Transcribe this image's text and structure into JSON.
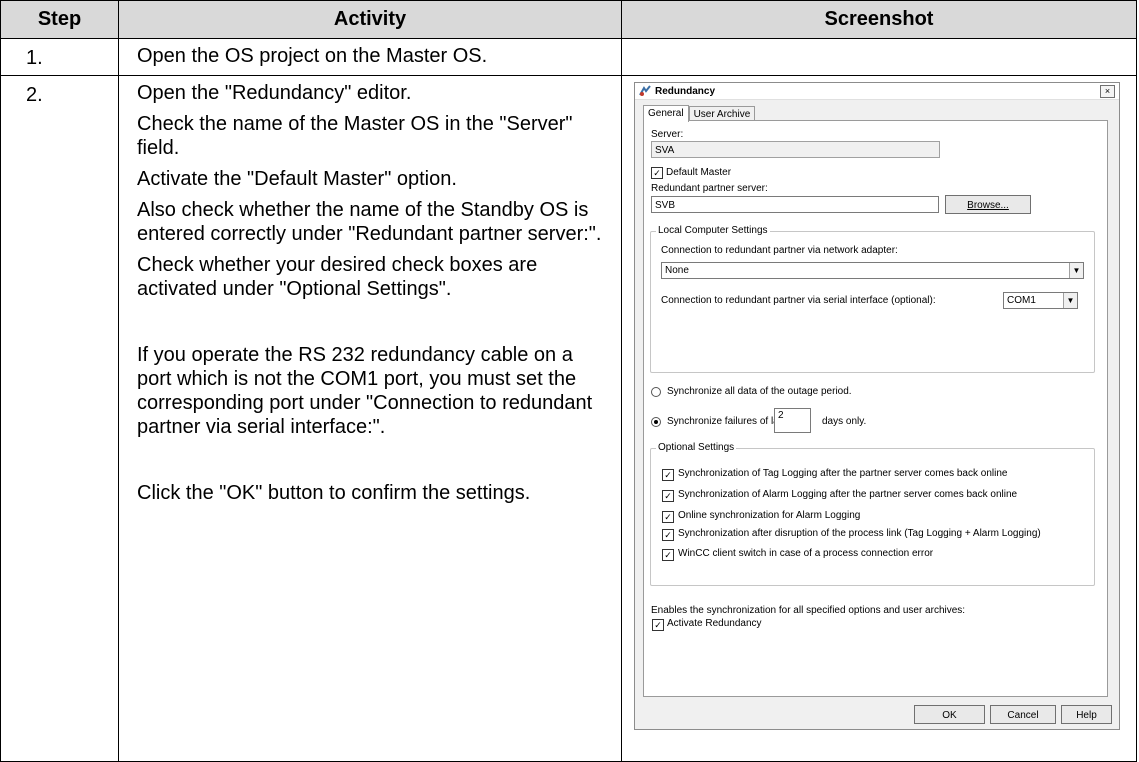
{
  "table": {
    "headers": [
      "Step",
      "Activity",
      "Screenshot"
    ],
    "rows": [
      {
        "step": "1.",
        "activity": [
          "Open the OS project on the Master OS."
        ]
      },
      {
        "step": "2.",
        "activity": [
          "Open the \"Redundancy\" editor.",
          "Check the name of the Master OS in the \"Server\" field.",
          "Activate the \"Default Master\" option.",
          "Also check whether the name of the Standby OS is entered correctly under \"Redundant partner server:\".",
          "Check whether your desired check boxes are activated under \"Optional Settings\".",
          "If you operate the RS 232 redundancy cable on a port which is not the COM1 port, you must set the corresponding port under \"Connection to redundant partner via serial interface:\".",
          "Click the \"OK\" button to confirm the settings."
        ]
      }
    ]
  },
  "dialog": {
    "title": "Redundancy",
    "close_glyph": "×",
    "tabs": [
      "General",
      "User Archive"
    ],
    "server_label": "Server:",
    "server_value": "SVA",
    "default_master_label": "Default Master",
    "default_master_checked": true,
    "partner_label": "Redundant partner server:",
    "partner_value": "SVB",
    "browse_label": "Browse...",
    "local_group": {
      "legend": "Local Computer Settings",
      "network_label": "Connection to redundant partner via network adapter:",
      "network_value": "None",
      "serial_label": "Connection to redundant partner via serial interface (optional):",
      "serial_value": "COM1"
    },
    "sync_all_label": "Synchronize all data of the outage period.",
    "sync_last_label": "Synchronize failures of last",
    "sync_days_value": "2",
    "sync_days_suffix": "days only.",
    "sync_selected": "last",
    "optional_group": {
      "legend": "Optional Settings",
      "options": [
        "Synchronization of Tag Logging after the partner server comes back online",
        "Synchronization of Alarm Logging after the partner server comes back online",
        "Online synchronization for Alarm Logging",
        "Synchronization after disruption of the process link (Tag Logging + Alarm Logging)",
        "WinCC client switch in case of a process connection error"
      ]
    },
    "enable_text": "Enables the synchronization for all specified options and user archives:",
    "activate_label": "Activate Redundancy",
    "buttons": {
      "ok": "OK",
      "cancel": "Cancel",
      "help": "Help"
    },
    "check_glyph": "✓",
    "dropdown_glyph": "▼"
  }
}
